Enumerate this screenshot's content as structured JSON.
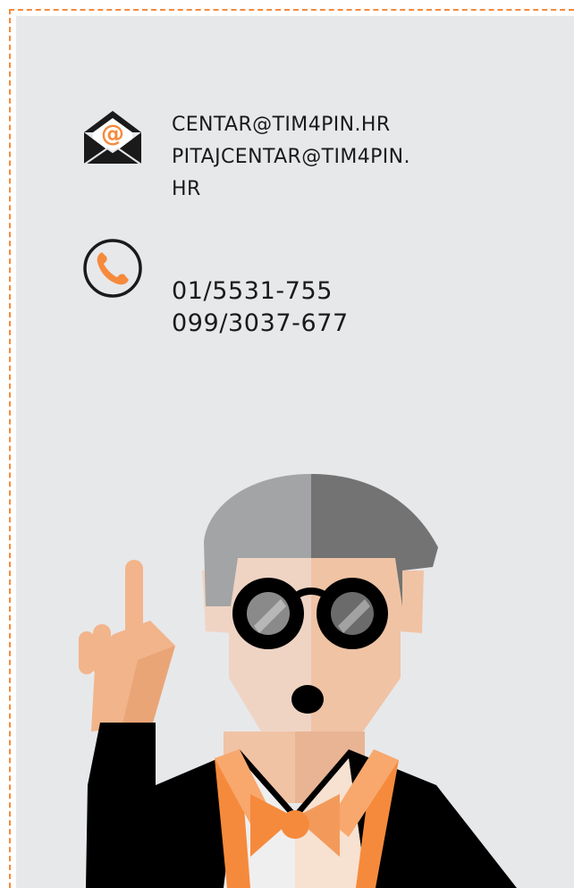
{
  "contact": {
    "emails": [
      "CENTAR@TIM4PIN.HR",
      "PITAJCENTAR@TIM4PIN.",
      "HR"
    ],
    "phones": [
      "01/5531-755",
      "099/3037-677"
    ]
  },
  "icons": {
    "email": "envelope-at-icon",
    "phone": "phone-icon"
  },
  "colors": {
    "accent": "#f58a3c",
    "panel": "#e7e8ea",
    "text": "#1a1a1a"
  }
}
